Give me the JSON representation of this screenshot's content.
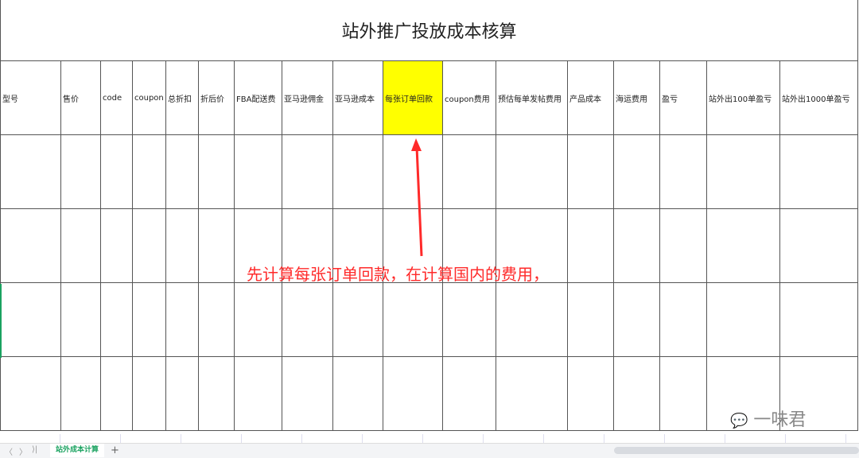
{
  "sheet": {
    "title": "站外推广投放成本核算",
    "headers": [
      "型号",
      "售价",
      "code",
      "coupon",
      "总折扣",
      "折后价",
      "FBA配送费",
      "亚马逊佣金",
      "亚马逊成本",
      "每张订单回款",
      "coupon费用",
      "预估每单发帖费用",
      "产品成本",
      "海运费用",
      "盈亏",
      "站外出100单盈亏",
      "站外出1000单盈亏"
    ],
    "highlight_color": "#ffff00"
  },
  "annotation": "先计算每张订单回款，在计算国内的费用，",
  "tabs": {
    "active": "站外成本计算",
    "add": "+"
  },
  "nav": {
    "prev": "〈",
    "next": "〉",
    "last": "⟩|"
  },
  "watermark": "一味君"
}
